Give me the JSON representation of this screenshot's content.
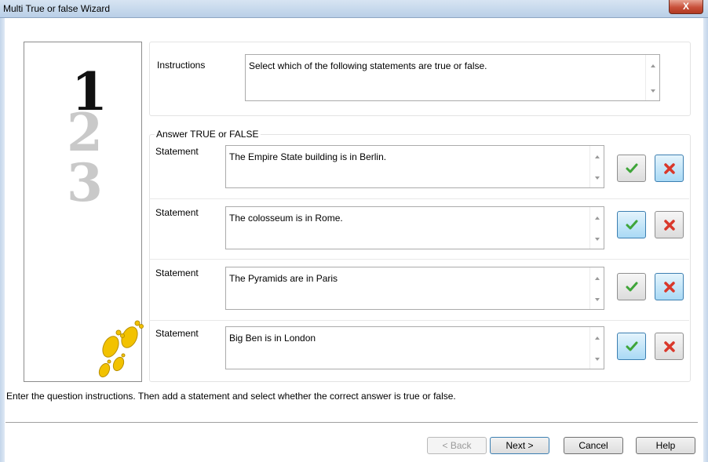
{
  "window": {
    "title": "Multi True or false Wizard",
    "close_label": "X"
  },
  "steps": [
    "1",
    "2",
    "3"
  ],
  "instructions": {
    "label": "Instructions",
    "value": "Select which of the following statements are true or false."
  },
  "answers": {
    "group_title": "Answer TRUE or FALSE",
    "statements": [
      {
        "label": "Statement",
        "value": "The Empire State building is in Berlin.",
        "answer": "false"
      },
      {
        "label": "Statement",
        "value": "The colosseum is in Rome.",
        "answer": "true"
      },
      {
        "label": "Statement",
        "value": "The Pyramids are in Paris",
        "answer": "false"
      },
      {
        "label": "Statement",
        "value": "Big Ben is in London",
        "answer": "true"
      }
    ]
  },
  "icons": {
    "true": "checkmark-icon",
    "false": "cross-icon",
    "decoration": "footprints-icon"
  },
  "colors": {
    "check": "#3fa53a",
    "cross": "#d9382b",
    "selected": "#a9d9f5",
    "footprints": "#f2c200"
  },
  "hint": "Enter the question instructions. Then add a statement and select whether the correct answer is true or false.",
  "footer": {
    "back": "< Back",
    "next": "Next >",
    "cancel": "Cancel",
    "help": "Help"
  }
}
